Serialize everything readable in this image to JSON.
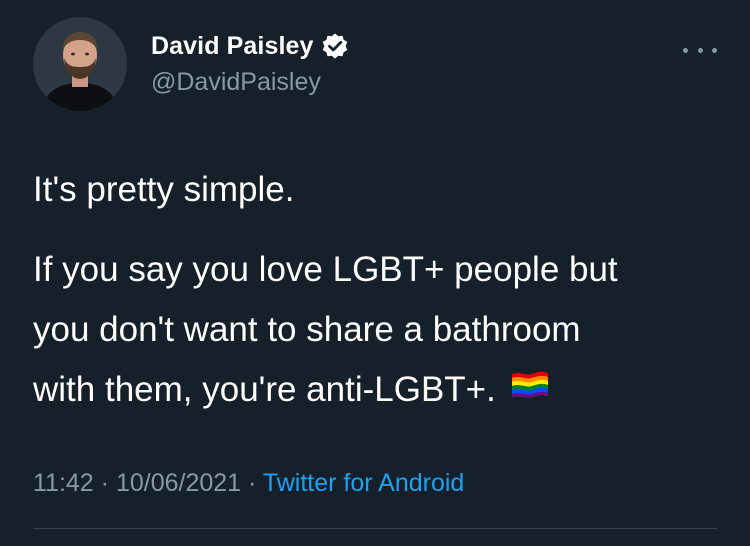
{
  "tweet": {
    "display_name": "David Paisley",
    "handle": "@DavidPaisley",
    "verified": true,
    "text_lines": [
      "It's pretty simple.",
      "If you say you love LGBT+ people but",
      "you don't want to share a bathroom",
      "with them, you're anti-LGBT+."
    ],
    "time": "11:42",
    "separator": "·",
    "date": "10/06/2021",
    "source": "Twitter for Android"
  },
  "icons": {
    "verified": "verified-badge-icon",
    "more": "more-options-icon",
    "flag": "rainbow-flag-icon"
  },
  "colors": {
    "background": "#15202b",
    "text": "#ffffff",
    "secondary": "#8899a6",
    "link": "#1da1f2",
    "divider": "#38444d"
  }
}
